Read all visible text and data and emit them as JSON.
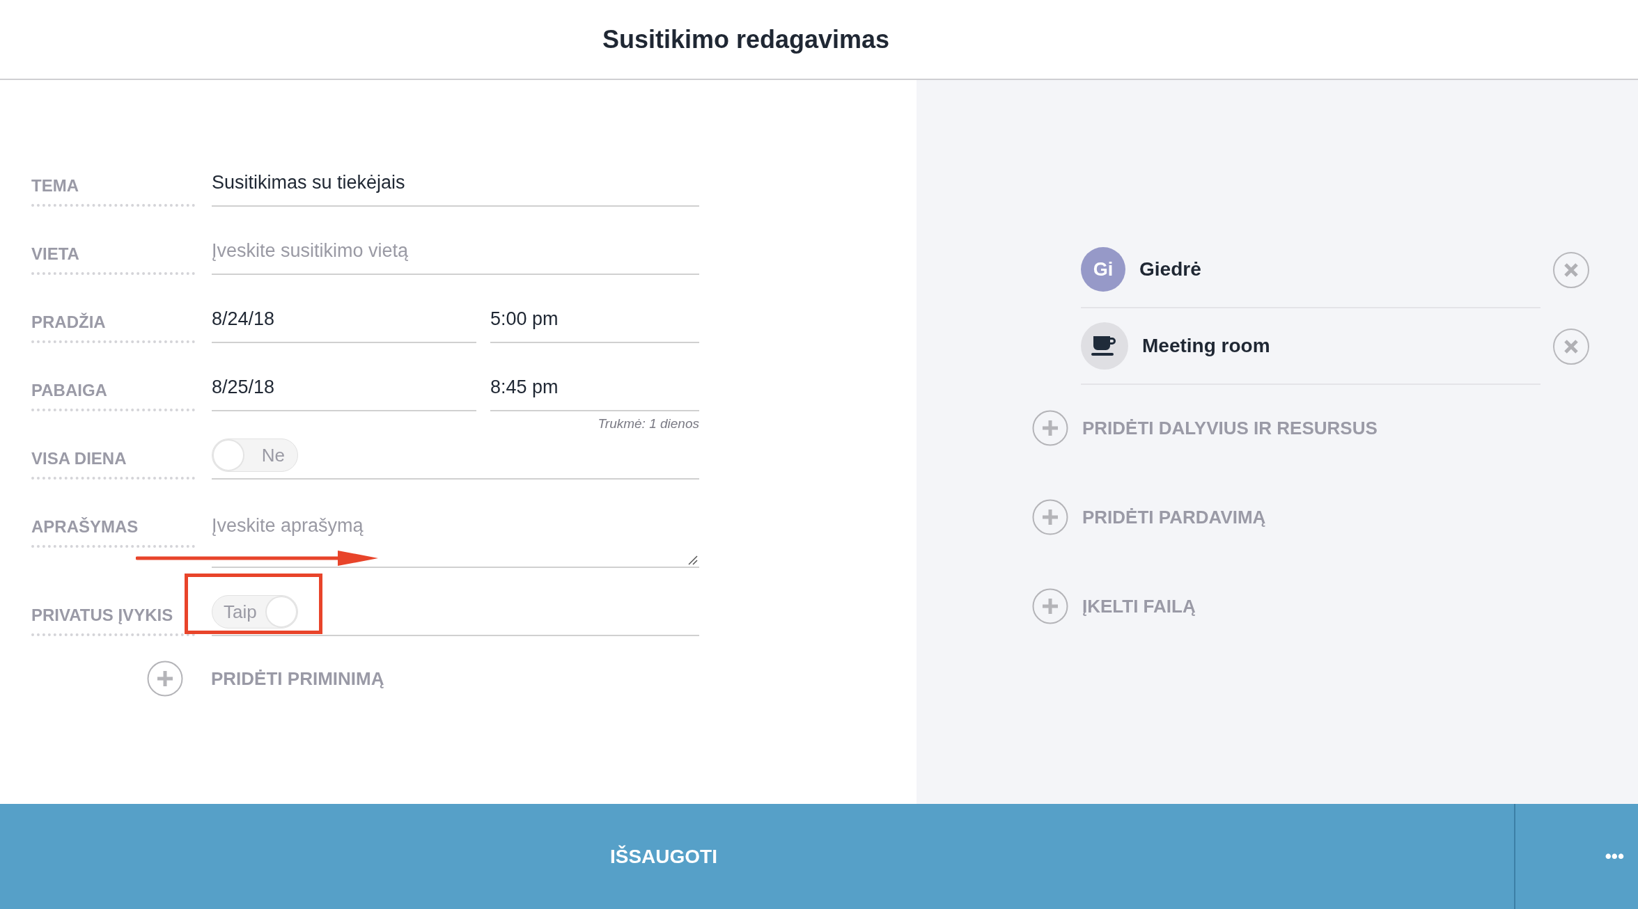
{
  "window": {
    "title": "Susitikimo redagavimas"
  },
  "form": {
    "fields": [
      {
        "kind": "text",
        "label": "TEMA",
        "value": "Susitikimas su tiekėjais"
      },
      {
        "kind": "text",
        "label": "VIETA",
        "placeholder": "Įveskite susitikimo vietą"
      },
      {
        "kind": "datetime",
        "label": "PRADŽIA",
        "date": "8/24/18",
        "time": "5:00 pm"
      },
      {
        "kind": "datetime",
        "label": "PABAIGA",
        "date": "8/25/18",
        "time": "8:45 pm",
        "note": "Trukmė: 1 dienos"
      },
      {
        "kind": "toggle",
        "label": "VISA DIENA",
        "toggle_text": "Ne",
        "on": false
      },
      {
        "kind": "textarea",
        "label": "APRAŠYMAS",
        "placeholder": "Įveskite aprašymą"
      },
      {
        "kind": "toggle",
        "label": "PRIVATUS ĮVYKIS",
        "toggle_text": "Taip",
        "on": true
      }
    ],
    "add_reminder": "PRIDĖTI PRIMINIMĄ"
  },
  "participants": [
    {
      "kind": "person",
      "initials": "Gi",
      "name": "Giedrė",
      "color": "#9699c8"
    },
    {
      "kind": "resource",
      "name": "Meeting room"
    }
  ],
  "actions": [
    "PRIDĖTI DALYVIUS IR RESURSUS",
    "PRIDĖTI PARDAVIMĄ",
    "ĮKELTI FAILĄ"
  ],
  "annotations": {
    "arrow": true,
    "highlight_box": true
  },
  "footer": {
    "save": "IŠSAUGOTI",
    "more": "•••"
  }
}
